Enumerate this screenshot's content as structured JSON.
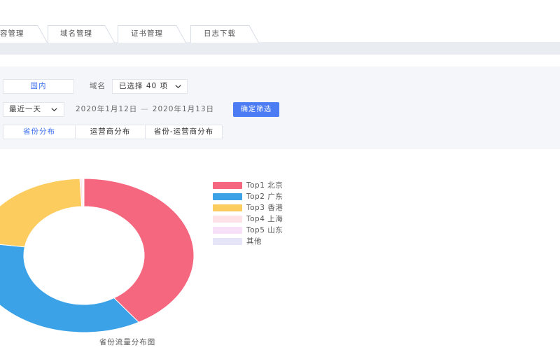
{
  "tabs": [
    {
      "label": "容管理"
    },
    {
      "label": "域名管理"
    },
    {
      "label": "证书管理"
    },
    {
      "label": "日志下载"
    }
  ],
  "theme": {
    "primary": "#4c7cf3",
    "active_text": "#3d6ef0"
  },
  "filters": {
    "region": {
      "label": "国内",
      "selected": true
    },
    "domain": {
      "label": "域名",
      "value": "已选择 40 项",
      "icon": "chevron-down-icon"
    },
    "period": {
      "value": "最近一天",
      "icon": "chevron-down-icon"
    },
    "date_range": {
      "start": "2020年1月12日",
      "separator": "—",
      "end": "2020年1月13日"
    },
    "confirm_label": "确定筛选",
    "views": [
      {
        "label": "省份分布",
        "active": true
      },
      {
        "label": "运营商分布",
        "active": false
      },
      {
        "label": "省份-运营商分布",
        "active": false
      }
    ]
  },
  "chart_data": {
    "type": "pie",
    "donut": true,
    "title": "省份流量分布图",
    "legend_position": "right",
    "categories": [
      "Top1 北京",
      "Top2 广东",
      "Top3 香港",
      "Top4 上海",
      "Top5 山东",
      "其他"
    ],
    "values": [
      41.7,
      36.1,
      21.6,
      0.3,
      0.2,
      0.1
    ],
    "colors": [
      "#f5667f",
      "#3ba2e7",
      "#fccc5e",
      "#fde3e8",
      "#f8e0f8",
      "#e5e4f8"
    ]
  }
}
